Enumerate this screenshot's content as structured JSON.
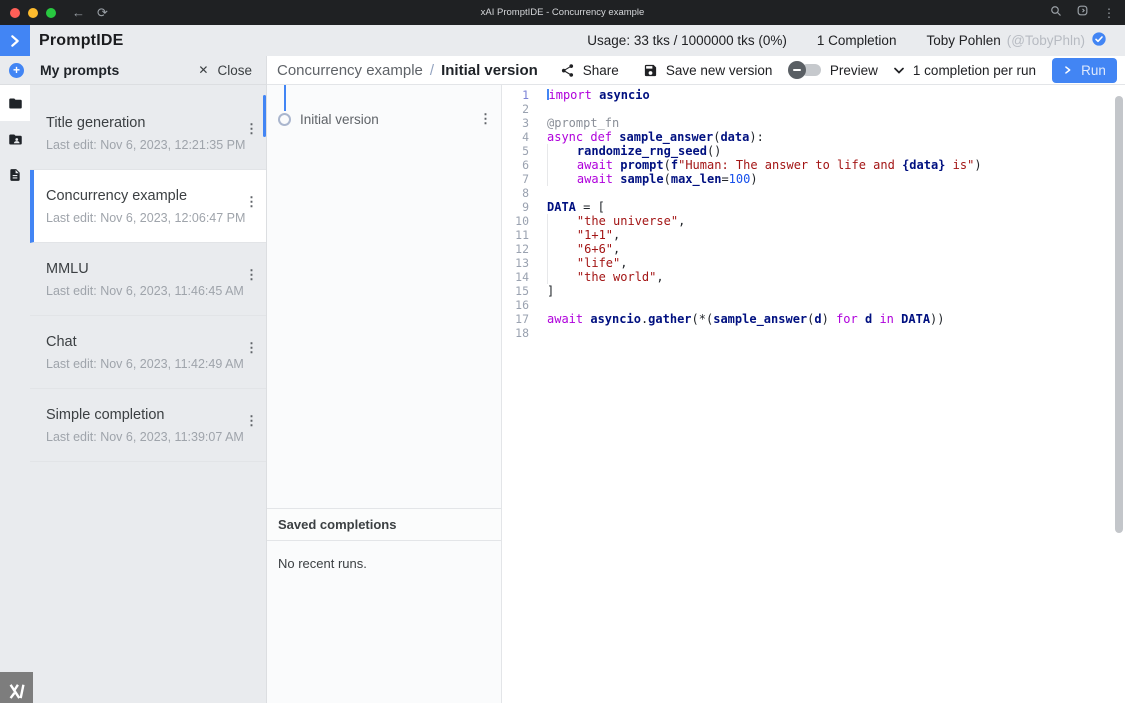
{
  "titlebar": {
    "title": "xAI PromptIDE - Concurrency example",
    "back_icon": "←",
    "reload_icon": "⟳",
    "menu_icon": "⋮"
  },
  "header": {
    "app_name": "PromptIDE",
    "usage": "Usage: 33 tks / 1000000 tks (0%)",
    "completions": "1 Completion",
    "user_name": "Toby Pohlen",
    "user_handle": "(@TobyPhln)"
  },
  "sidebar": {
    "title": "My prompts",
    "close_label": "Close",
    "close_icon": "✕",
    "item_menu_icon": "⋮",
    "items": [
      {
        "title": "Title generation",
        "subtitle": "Last edit: Nov 6, 2023, 12:21:35 PM",
        "selected": false
      },
      {
        "title": "Concurrency example",
        "subtitle": "Last edit: Nov 6, 2023, 12:06:47 PM",
        "selected": true
      },
      {
        "title": "MMLU",
        "subtitle": "Last edit: Nov 6, 2023, 11:46:45 AM",
        "selected": false
      },
      {
        "title": "Chat",
        "subtitle": "Last edit: Nov 6, 2023, 11:42:49 AM",
        "selected": false
      },
      {
        "title": "Simple completion",
        "subtitle": "Last edit: Nov 6, 2023, 11:39:07 AM",
        "selected": false
      }
    ]
  },
  "toolbar": {
    "breadcrumb_parent": "Concurrency example",
    "breadcrumb_separator": "/",
    "breadcrumb_current": "Initial version",
    "share_label": "Share",
    "save_label": "Save new version",
    "preview_label": "Preview",
    "completions_per_run": "1 completion per run",
    "run_label": "Run"
  },
  "versions": {
    "items": [
      {
        "label": "Initial version"
      }
    ],
    "menu_icon": "⋮",
    "saved_completions_title": "Saved completions",
    "empty_runs_text": "No recent runs."
  },
  "editor": {
    "cursor_line": 1,
    "lines": [
      {
        "num": 1,
        "tokens": [
          {
            "c": "kw",
            "t": "import"
          },
          {
            "c": "pl",
            "t": " "
          },
          {
            "c": "id",
            "t": "asyncio"
          }
        ]
      },
      {
        "num": 2,
        "tokens": []
      },
      {
        "num": 3,
        "tokens": [
          {
            "c": "dec",
            "t": "@prompt_fn"
          }
        ]
      },
      {
        "num": 4,
        "tokens": [
          {
            "c": "kw",
            "t": "async"
          },
          {
            "c": "pl",
            "t": " "
          },
          {
            "c": "kw",
            "t": "def"
          },
          {
            "c": "pl",
            "t": " "
          },
          {
            "c": "id",
            "t": "sample_answer"
          },
          {
            "c": "pl",
            "t": "("
          },
          {
            "c": "id",
            "t": "data"
          },
          {
            "c": "pl",
            "t": "):"
          }
        ]
      },
      {
        "num": 5,
        "tokens": [
          {
            "c": "ind",
            "t": "    "
          },
          {
            "c": "id",
            "t": "randomize_rng_seed"
          },
          {
            "c": "pl",
            "t": "()"
          }
        ]
      },
      {
        "num": 6,
        "tokens": [
          {
            "c": "ind",
            "t": "    "
          },
          {
            "c": "kw",
            "t": "await"
          },
          {
            "c": "pl",
            "t": " "
          },
          {
            "c": "id",
            "t": "prompt"
          },
          {
            "c": "pl",
            "t": "("
          },
          {
            "c": "id",
            "t": "f"
          },
          {
            "c": "str",
            "t": "\"Human: The answer to life and "
          },
          {
            "c": "id",
            "t": "{data}"
          },
          {
            "c": "str",
            "t": " is\""
          },
          {
            "c": "pl",
            "t": ")"
          }
        ]
      },
      {
        "num": 7,
        "tokens": [
          {
            "c": "ind",
            "t": "    "
          },
          {
            "c": "kw",
            "t": "await"
          },
          {
            "c": "pl",
            "t": " "
          },
          {
            "c": "id",
            "t": "sample"
          },
          {
            "c": "pl",
            "t": "("
          },
          {
            "c": "id",
            "t": "max_len"
          },
          {
            "c": "pl",
            "t": "="
          },
          {
            "c": "num",
            "t": "100"
          },
          {
            "c": "pl",
            "t": ")"
          }
        ]
      },
      {
        "num": 8,
        "tokens": []
      },
      {
        "num": 9,
        "tokens": [
          {
            "c": "id",
            "t": "DATA"
          },
          {
            "c": "pl",
            "t": " = ["
          }
        ]
      },
      {
        "num": 10,
        "tokens": [
          {
            "c": "ind",
            "t": "    "
          },
          {
            "c": "str",
            "t": "\"the universe\""
          },
          {
            "c": "pl",
            "t": ","
          }
        ]
      },
      {
        "num": 11,
        "tokens": [
          {
            "c": "ind",
            "t": "    "
          },
          {
            "c": "str",
            "t": "\"1+1\""
          },
          {
            "c": "pl",
            "t": ","
          }
        ]
      },
      {
        "num": 12,
        "tokens": [
          {
            "c": "ind",
            "t": "    "
          },
          {
            "c": "str",
            "t": "\"6+6\""
          },
          {
            "c": "pl",
            "t": ","
          }
        ]
      },
      {
        "num": 13,
        "tokens": [
          {
            "c": "ind",
            "t": "    "
          },
          {
            "c": "str",
            "t": "\"life\""
          },
          {
            "c": "pl",
            "t": ","
          }
        ]
      },
      {
        "num": 14,
        "tokens": [
          {
            "c": "ind",
            "t": "    "
          },
          {
            "c": "str",
            "t": "\"the world\""
          },
          {
            "c": "pl",
            "t": ","
          }
        ]
      },
      {
        "num": 15,
        "tokens": [
          {
            "c": "pl",
            "t": "]"
          }
        ]
      },
      {
        "num": 16,
        "tokens": []
      },
      {
        "num": 17,
        "tokens": [
          {
            "c": "kw",
            "t": "await"
          },
          {
            "c": "pl",
            "t": " "
          },
          {
            "c": "id",
            "t": "asyncio"
          },
          {
            "c": "pl",
            "t": "."
          },
          {
            "c": "id",
            "t": "gather"
          },
          {
            "c": "pl",
            "t": "(*("
          },
          {
            "c": "id",
            "t": "sample_answer"
          },
          {
            "c": "pl",
            "t": "("
          },
          {
            "c": "id",
            "t": "d"
          },
          {
            "c": "pl",
            "t": ") "
          },
          {
            "c": "kw",
            "t": "for"
          },
          {
            "c": "pl",
            "t": " "
          },
          {
            "c": "id",
            "t": "d"
          },
          {
            "c": "pl",
            "t": " "
          },
          {
            "c": "kw",
            "t": "in"
          },
          {
            "c": "pl",
            "t": " "
          },
          {
            "c": "id",
            "t": "DATA"
          },
          {
            "c": "pl",
            "t": "))"
          }
        ]
      },
      {
        "num": 18,
        "tokens": []
      }
    ]
  },
  "colors": {
    "accent": "#4285f4",
    "titlebar_bg": "#1f2123",
    "page_bg": "#e9ebee",
    "keyword": "#af00db",
    "identifier": "#001080",
    "string": "#a31515",
    "number": "#1750eb",
    "decorator": "#8a8f98",
    "traffic_red": "#ff5f57",
    "traffic_yellow": "#febc2e",
    "traffic_green": "#28c840"
  }
}
